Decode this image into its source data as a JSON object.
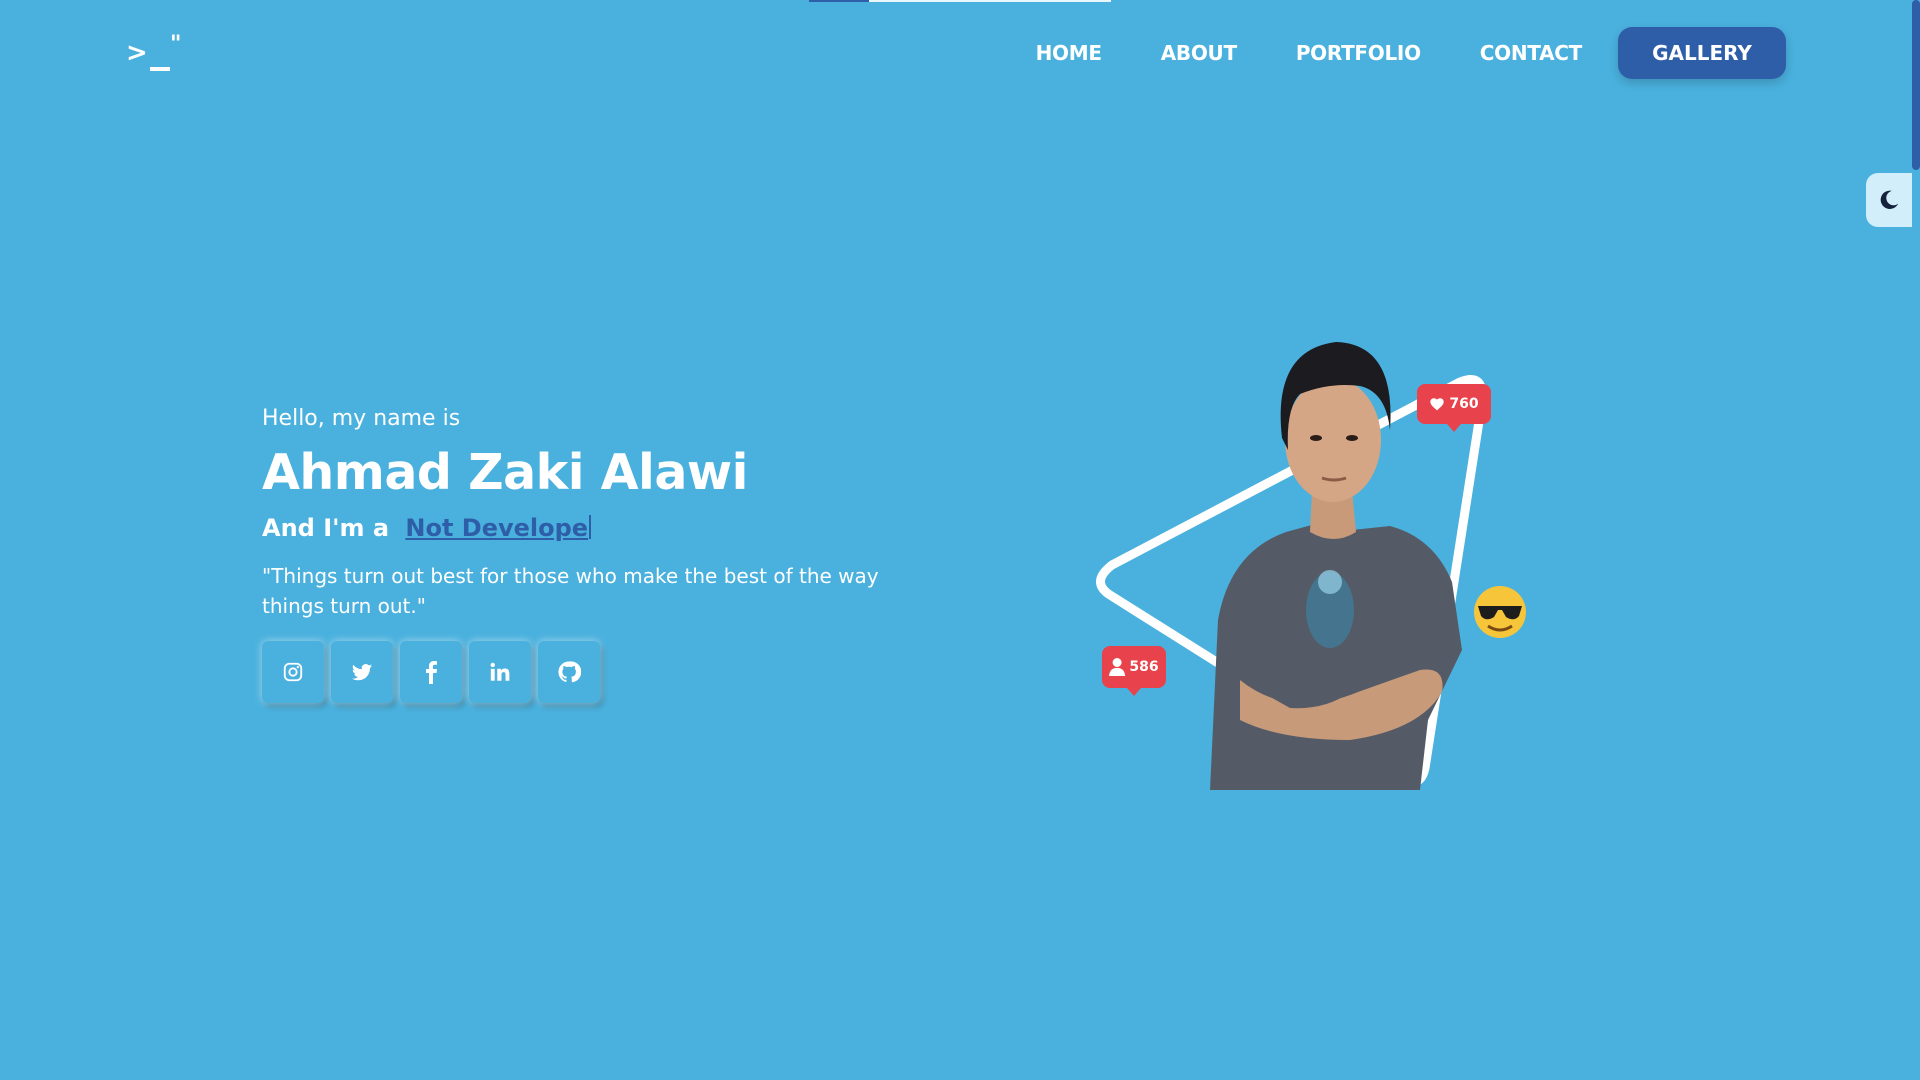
{
  "logo": {
    "chevron": ">",
    "quote": "\""
  },
  "nav": {
    "items": [
      {
        "label": "HOME"
      },
      {
        "label": "ABOUT"
      },
      {
        "label": "PORTFOLIO"
      },
      {
        "label": "CONTACT"
      }
    ],
    "cta_label": "GALLERY"
  },
  "hero": {
    "greeting": "Hello, my name is",
    "name": "Ahmad Zaki Alawi",
    "role_prefix": "And I'm a",
    "role_typed": "Not Develope",
    "quote": "\"Things turn out best for those who make the best of the way things turn out.\""
  },
  "socials": [
    "instagram-icon",
    "twitter-icon",
    "facebook-icon",
    "linkedin-icon",
    "github-icon"
  ],
  "badges": {
    "likes": "760",
    "followers": "586"
  },
  "colors": {
    "background": "#4ab1de",
    "accent": "#2f5ea8",
    "badge": "#e8434c",
    "toggle_bg": "#d3eefb"
  }
}
